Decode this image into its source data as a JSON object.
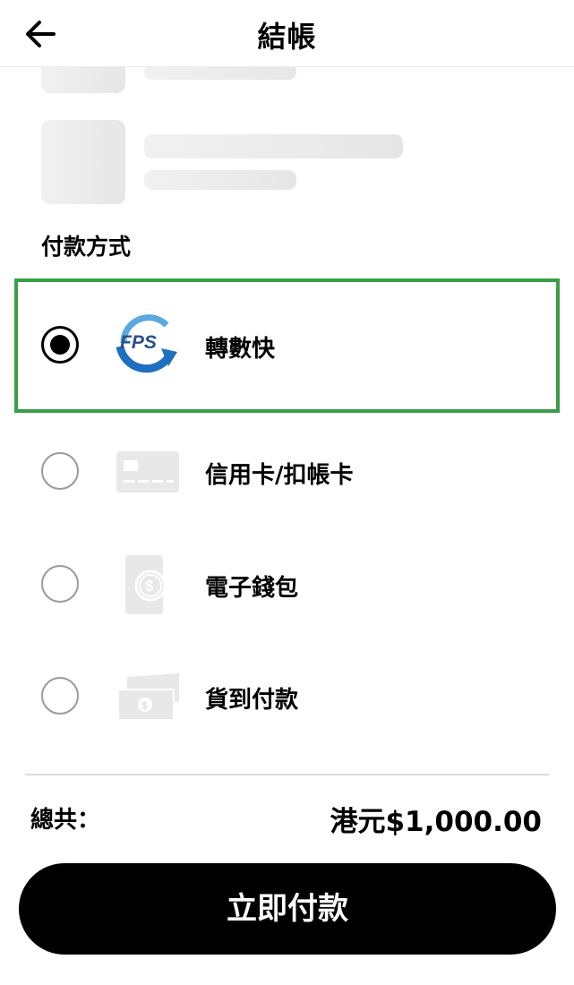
{
  "header": {
    "title": "結帳"
  },
  "payment": {
    "section_label": "付款方式",
    "options": [
      {
        "label": "轉數快",
        "icon": "fps-logo",
        "selected": true,
        "logo_text": "FPS"
      },
      {
        "label": "信用卡/扣帳卡",
        "icon": "credit-card-icon",
        "selected": false
      },
      {
        "label": "電子錢包",
        "icon": "e-wallet-icon",
        "selected": false
      },
      {
        "label": "貨到付款",
        "icon": "cash-icon",
        "selected": false
      }
    ],
    "selected_color": "#3a9d48"
  },
  "summary": {
    "total_label": "總共：",
    "total_value": "港元$1,000.00"
  },
  "actions": {
    "pay_label": "立即付款"
  }
}
